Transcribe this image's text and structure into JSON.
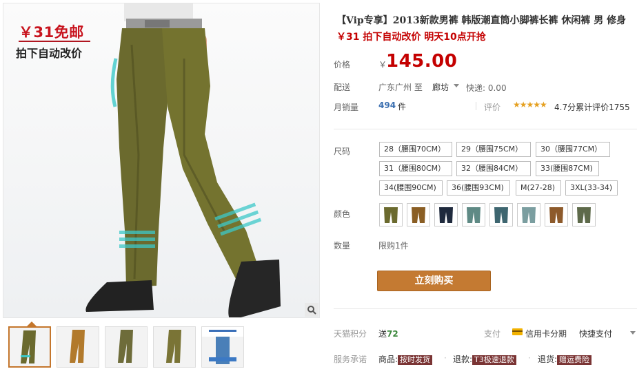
{
  "promo": {
    "price": "￥31免邮",
    "subtitle": "拍下自动改价"
  },
  "product": {
    "title": "【Vip专享】2013新款男裤 韩版潮直筒小脚裤长裤 休闲裤 男 修身",
    "subtitle": "￥31 拍下自动改价 明天10点开抢"
  },
  "price": {
    "label": "价格",
    "currency": "￥",
    "value": "145.00"
  },
  "shipping": {
    "label": "配送",
    "from": "广东广州  至",
    "to": "廊坊",
    "express": "快递: 0.00"
  },
  "sales": {
    "label": "月销量",
    "count": "494",
    "unit": "件",
    "rating_label": "评价",
    "stars": "★★★★★",
    "score_text": "4.7分累计评价1755"
  },
  "size": {
    "label": "尺码",
    "options": [
      "28（腰围70CM）",
      "29（腰围75CM）",
      "30（腰围77CM）",
      "31（腰围80CM）",
      "32（腰围84CM）",
      "33(腰围87CM)",
      "34(腰围90CM)",
      "36(腰围93CM)",
      "M(27-28)",
      "3XL(33-34)"
    ]
  },
  "color": {
    "label": "颜色",
    "swatch_colors": [
      "#6b6a2e",
      "#8a5e24",
      "#1f2a3d",
      "#5f8a85",
      "#3e6670",
      "#7b9ea0",
      "#8d5a2b",
      "#5e6a4a"
    ]
  },
  "quantity": {
    "label": "数量",
    "limit": "限购1件"
  },
  "buy_button": "立刻购买",
  "points": {
    "label": "天猫积分",
    "prefix": "送",
    "value": "72"
  },
  "payment": {
    "label": "支付",
    "card": "信用卡分期",
    "quick": "快捷支付"
  },
  "service": {
    "label": "服务承诺",
    "item1_prefix": "商品:",
    "item1_tag": "按时发货",
    "item2_prefix": "退款:",
    "item2_tag": "T3极速退款",
    "item3_prefix": "退货:",
    "item3_tag": "赠运费险"
  }
}
